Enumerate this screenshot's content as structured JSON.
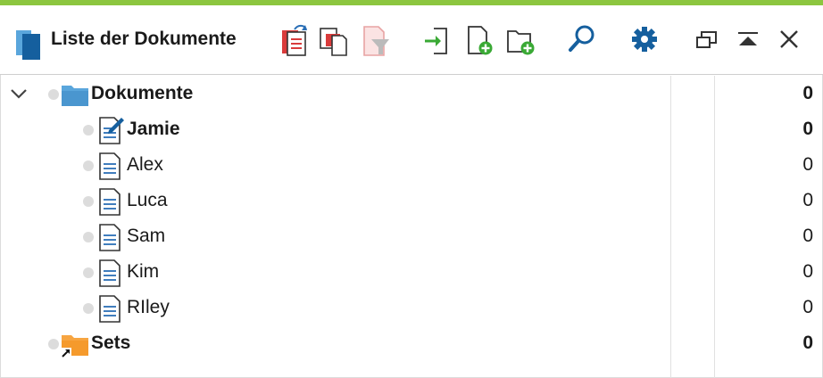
{
  "window": {
    "title": "Liste der Dokumente",
    "accent_color": "#8cc63f",
    "title_icon": "document-stack-icon"
  },
  "toolbar": {
    "buttons": [
      {
        "name": "activate-all-icon"
      },
      {
        "name": "copy-documents-icon"
      },
      {
        "name": "document-filter-icon"
      },
      {
        "name": "import-document-icon"
      },
      {
        "name": "new-document-icon"
      },
      {
        "name": "new-document-group-icon"
      },
      {
        "name": "search-icon"
      },
      {
        "name": "settings-gear-icon"
      },
      {
        "name": "undock-window-icon"
      },
      {
        "name": "collapse-window-icon"
      },
      {
        "name": "close-icon"
      }
    ]
  },
  "tree": {
    "root": {
      "label": "Dokumente",
      "count": "0",
      "icon": "folder-icon",
      "expanded": true
    },
    "documents": [
      {
        "label": "Jamie",
        "count": "0",
        "icon": "document-edit-icon",
        "bold": true
      },
      {
        "label": "Alex",
        "count": "0",
        "icon": "document-icon"
      },
      {
        "label": "Luca",
        "count": "0",
        "icon": "document-icon"
      },
      {
        "label": "Sam",
        "count": "0",
        "icon": "document-icon"
      },
      {
        "label": "Kim",
        "count": "0",
        "icon": "document-icon"
      },
      {
        "label": "RIley",
        "count": "0",
        "icon": "document-icon"
      }
    ],
    "sets": {
      "label": "Sets",
      "count": "0",
      "icon": "sets-folder-icon"
    }
  }
}
